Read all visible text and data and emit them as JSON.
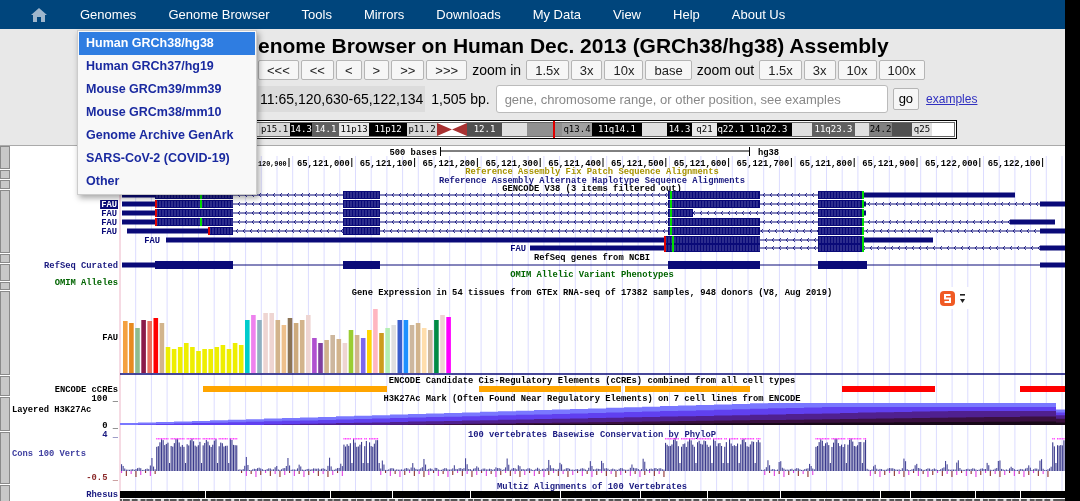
{
  "nav": {
    "items": [
      "Genomes",
      "Genome Browser",
      "Tools",
      "Mirrors",
      "Downloads",
      "My Data",
      "View",
      "Help",
      "About Us"
    ]
  },
  "genomes_menu": [
    {
      "label": "Human GRCh38/hg38",
      "selected": true
    },
    {
      "label": "Human GRCh37/hg19",
      "selected": false
    },
    {
      "label": "Mouse GRCm39/mm39",
      "selected": false
    },
    {
      "label": "Mouse GRCm38/mm10",
      "selected": false
    },
    {
      "label": "Genome Archive GenArk",
      "selected": false
    },
    {
      "label": "SARS-CoV-2 (COVID-19)",
      "selected": false
    },
    {
      "label": "Other",
      "selected": false
    }
  ],
  "title": "enome Browser on Human Dec. 2013 (GRCh38/hg38) Assembly",
  "move_buttons": [
    "<<<",
    "<<",
    "<",
    ">",
    ">>",
    ">>>"
  ],
  "zoom_in": {
    "label": "zoom in",
    "buttons": [
      "1.5x",
      "3x",
      "10x",
      "base"
    ]
  },
  "zoom_out": {
    "label": "zoom out",
    "buttons": [
      "1.5x",
      "3x",
      "10x",
      "100x"
    ]
  },
  "position": "11:65,120,630-65,122,134",
  "size": "1,505 bp.",
  "search": {
    "placeholder": "gene, chromosome range, or other position, see examples"
  },
  "go_button": "go",
  "examples_link": "examples",
  "ideogram": [
    {
      "label": "p15.1",
      "color": "#d8d8d8"
    },
    {
      "label": "14.3",
      "color": "#000000"
    },
    {
      "label": "14.1",
      "color": "#606060"
    },
    {
      "label": "11p13",
      "color": "#e8e8e8"
    },
    {
      "label": "11p12",
      "color": "#000000"
    },
    {
      "label": "p11.2",
      "color": "#d8d8d8"
    },
    {
      "kind": "centromere",
      "color": "#a83232"
    },
    {
      "label": "12.1",
      "color": "#505050"
    },
    {
      "color": "#e0e0e0"
    },
    {
      "color": "#909090"
    },
    {
      "label": "q13.4",
      "color": "#a0a0a0"
    },
    {
      "label": "11q14.1",
      "color": "#000000"
    },
    {
      "color": "#e0e0e0"
    },
    {
      "label": "14.3",
      "color": "#000000"
    },
    {
      "label": "q21",
      "color": "#e8e8e8"
    },
    {
      "label": "q22.1",
      "color": "#000000"
    },
    {
      "label": "11q22.3",
      "color": "#000000"
    },
    {
      "color": "#e0e0e0"
    },
    {
      "label": "11q23.3",
      "color": "#606060"
    },
    {
      "color": "#e0e0e0"
    },
    {
      "label": "24.2",
      "color": "#808080"
    },
    {
      "color": "#505050"
    },
    {
      "label": "q25",
      "color": "#e0e0e0"
    }
  ],
  "tracks": {
    "scale": {
      "length": "500 bases",
      "assembly": "hg38"
    },
    "ruler_ticks": [
      "120,900",
      "65,121,000",
      "65,121,100",
      "65,121,200",
      "65,121,300",
      "65,121,400",
      "65,121,500",
      "65,121,600",
      "65,121,700",
      "65,121,800",
      "65,121,900",
      "65,122,000",
      "65,122,100"
    ],
    "titles": [
      {
        "text": "Reference Assembly Fix Patch Sequence Alignments",
        "color": "#a89400"
      },
      {
        "text": "Reference Assembly Alternate Haplotype Sequence Alignments",
        "color": "#1a1a80"
      },
      {
        "text": "GENCODE V38 (3 items filtered out)",
        "color": "#000000"
      },
      {
        "text": "RefSeq genes from NCBI",
        "color": "#000000"
      },
      {
        "text": "OMIM Allelic Variant Phenotypes",
        "color": "#006400"
      },
      {
        "text": "Gene Expression in 54 tissues from GTEx RNA-seq of 17382 samples, 948 donors (V8, Aug 2019)",
        "color": "#000000"
      },
      {
        "text": "ENCODE Candidate Cis-Regulatory Elements (cCREs) combined from all cell types",
        "color": "#000000"
      },
      {
        "text": "H3K27Ac Mark (Often Found Near Regulatory Elements) on 7 cell lines from ENCODE",
        "color": "#000000"
      },
      {
        "text": "100 vertebrates Basewise Conservation by PhyloP",
        "color": "#1a1a80"
      },
      {
        "text": "Multiz Alignments of 100 Vertebrates",
        "color": "#1a1a80"
      }
    ],
    "gene_labels": [
      {
        "label": "FAU",
        "highlighted": true
      },
      {
        "label": "FAU",
        "highlighted": false
      },
      {
        "label": "FAU",
        "highlighted": false
      },
      {
        "label": "FAU",
        "highlighted": false
      },
      {
        "label": "FAU",
        "highlighted": false
      },
      {
        "label": "FAU",
        "highlighted": false
      }
    ],
    "side_labels": [
      {
        "text": "RefSeq Curated",
        "color": "#1a1a80"
      },
      {
        "text": "OMIM Alleles",
        "color": "#006400"
      },
      {
        "text": "FAU",
        "color": "#000000"
      },
      {
        "text": "ENCODE cCREs",
        "color": "#000000"
      },
      {
        "text": "100 _",
        "color": "#000000"
      },
      {
        "text": "Layered H3K27Ac",
        "color": "#000000"
      },
      {
        "text": "0 _",
        "color": "#000000"
      },
      {
        "text": "4 _",
        "color": "#1a1a80"
      },
      {
        "text": "Cons 100 Verts",
        "color": "#4040a0"
      },
      {
        "text": "-0.5 _",
        "color": "#8b2a2a"
      },
      {
        "text": "Rhesus",
        "color": "#1a1a80"
      }
    ]
  }
}
